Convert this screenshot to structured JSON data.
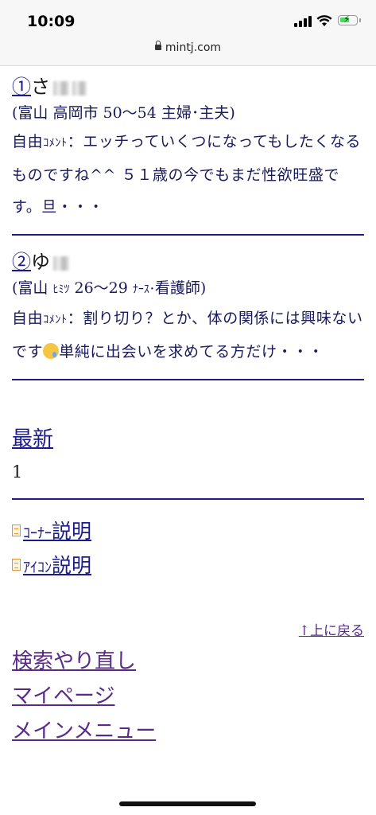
{
  "status": {
    "time": "10:09"
  },
  "browser": {
    "url": "mintj.com"
  },
  "entries": [
    {
      "num": "①",
      "name": "さ",
      "meta_open": "(富山 高岡市 50〜54 主婦･主夫)",
      "comment_prefix": "自由",
      "comment_prefix_small": "ｺﾒﾝﾄ",
      "comment_text": "：エッチっていくつになってもしたくなるものですね^^ ５１歳の今でもまだ性欲旺盛です。旦・・・"
    },
    {
      "num": "②",
      "name": "ゆ",
      "meta_a": "(富山 ",
      "meta_small_a": "ﾋﾐﾂ",
      "meta_b": " 26〜29 ",
      "meta_small_b": "ﾅｰｽ･",
      "meta_c": "看護師)",
      "comment_prefix": "自由",
      "comment_prefix_small": "ｺﾒﾝﾄ",
      "comment_text_a": "：割り切り？とか、体の関係には興味ないです",
      "emoji": "sad-relieved-face",
      "comment_text_b": "単純に出会いを求めてる方だけ・・・"
    }
  ],
  "pager": {
    "latest_label": "最新",
    "page": "1"
  },
  "links": {
    "corner_small": "ｺｰﾅｰ",
    "corner_rest": "説明",
    "icon_small": "ｱｲｺﾝ",
    "icon_rest": "説明"
  },
  "nav": {
    "back_top": "↑上に戻る",
    "research": "検索やり直し",
    "mypage": "マイページ",
    "mainmenu": "メインメニュー"
  },
  "colors": {
    "link": "#1a1a8c",
    "visited": "#5a2a8a",
    "rule": "#20207a"
  }
}
